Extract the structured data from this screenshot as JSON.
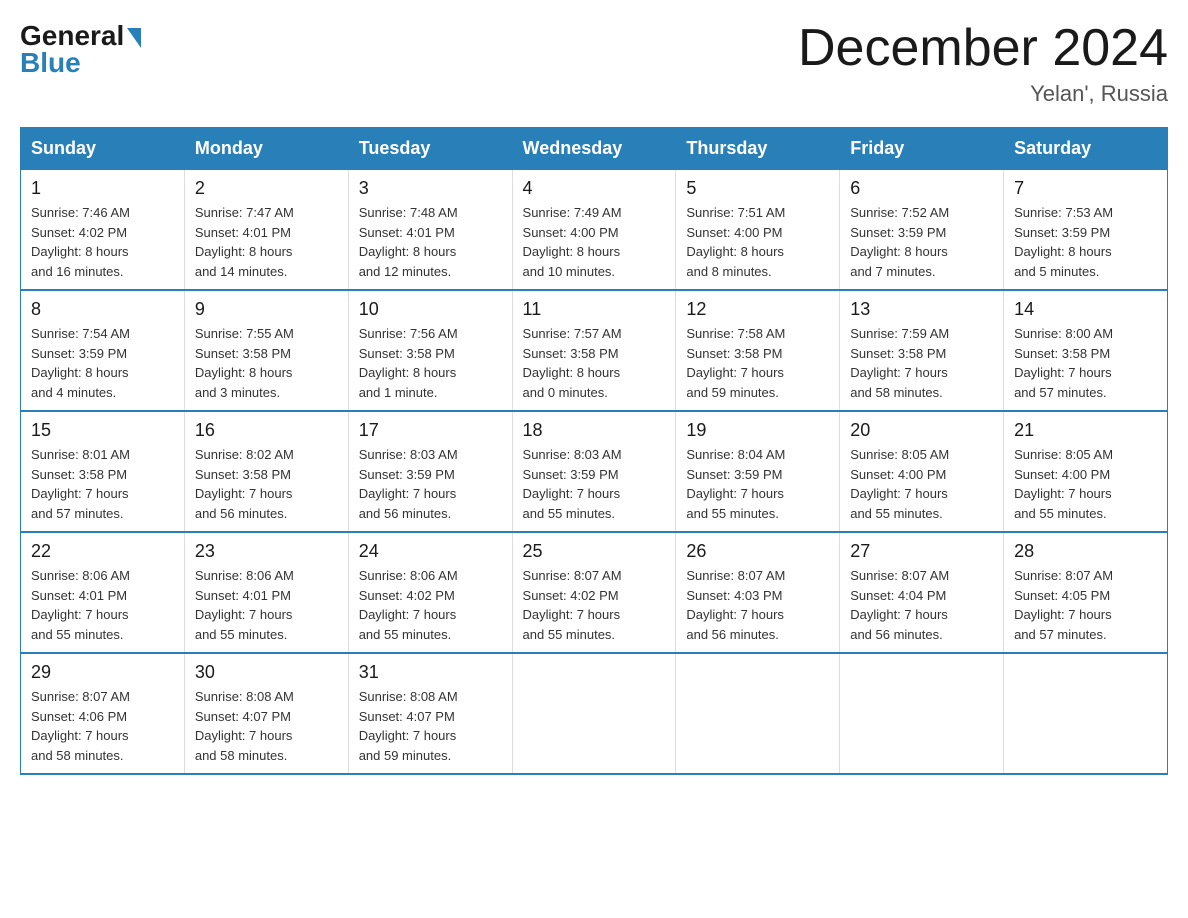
{
  "header": {
    "logo_general": "General",
    "logo_blue": "Blue",
    "month_title": "December 2024",
    "location": "Yelan', Russia"
  },
  "days_of_week": [
    "Sunday",
    "Monday",
    "Tuesday",
    "Wednesday",
    "Thursday",
    "Friday",
    "Saturday"
  ],
  "weeks": [
    [
      {
        "day": "1",
        "info": "Sunrise: 7:46 AM\nSunset: 4:02 PM\nDaylight: 8 hours\nand 16 minutes."
      },
      {
        "day": "2",
        "info": "Sunrise: 7:47 AM\nSunset: 4:01 PM\nDaylight: 8 hours\nand 14 minutes."
      },
      {
        "day": "3",
        "info": "Sunrise: 7:48 AM\nSunset: 4:01 PM\nDaylight: 8 hours\nand 12 minutes."
      },
      {
        "day": "4",
        "info": "Sunrise: 7:49 AM\nSunset: 4:00 PM\nDaylight: 8 hours\nand 10 minutes."
      },
      {
        "day": "5",
        "info": "Sunrise: 7:51 AM\nSunset: 4:00 PM\nDaylight: 8 hours\nand 8 minutes."
      },
      {
        "day": "6",
        "info": "Sunrise: 7:52 AM\nSunset: 3:59 PM\nDaylight: 8 hours\nand 7 minutes."
      },
      {
        "day": "7",
        "info": "Sunrise: 7:53 AM\nSunset: 3:59 PM\nDaylight: 8 hours\nand 5 minutes."
      }
    ],
    [
      {
        "day": "8",
        "info": "Sunrise: 7:54 AM\nSunset: 3:59 PM\nDaylight: 8 hours\nand 4 minutes."
      },
      {
        "day": "9",
        "info": "Sunrise: 7:55 AM\nSunset: 3:58 PM\nDaylight: 8 hours\nand 3 minutes."
      },
      {
        "day": "10",
        "info": "Sunrise: 7:56 AM\nSunset: 3:58 PM\nDaylight: 8 hours\nand 1 minute."
      },
      {
        "day": "11",
        "info": "Sunrise: 7:57 AM\nSunset: 3:58 PM\nDaylight: 8 hours\nand 0 minutes."
      },
      {
        "day": "12",
        "info": "Sunrise: 7:58 AM\nSunset: 3:58 PM\nDaylight: 7 hours\nand 59 minutes."
      },
      {
        "day": "13",
        "info": "Sunrise: 7:59 AM\nSunset: 3:58 PM\nDaylight: 7 hours\nand 58 minutes."
      },
      {
        "day": "14",
        "info": "Sunrise: 8:00 AM\nSunset: 3:58 PM\nDaylight: 7 hours\nand 57 minutes."
      }
    ],
    [
      {
        "day": "15",
        "info": "Sunrise: 8:01 AM\nSunset: 3:58 PM\nDaylight: 7 hours\nand 57 minutes."
      },
      {
        "day": "16",
        "info": "Sunrise: 8:02 AM\nSunset: 3:58 PM\nDaylight: 7 hours\nand 56 minutes."
      },
      {
        "day": "17",
        "info": "Sunrise: 8:03 AM\nSunset: 3:59 PM\nDaylight: 7 hours\nand 56 minutes."
      },
      {
        "day": "18",
        "info": "Sunrise: 8:03 AM\nSunset: 3:59 PM\nDaylight: 7 hours\nand 55 minutes."
      },
      {
        "day": "19",
        "info": "Sunrise: 8:04 AM\nSunset: 3:59 PM\nDaylight: 7 hours\nand 55 minutes."
      },
      {
        "day": "20",
        "info": "Sunrise: 8:05 AM\nSunset: 4:00 PM\nDaylight: 7 hours\nand 55 minutes."
      },
      {
        "day": "21",
        "info": "Sunrise: 8:05 AM\nSunset: 4:00 PM\nDaylight: 7 hours\nand 55 minutes."
      }
    ],
    [
      {
        "day": "22",
        "info": "Sunrise: 8:06 AM\nSunset: 4:01 PM\nDaylight: 7 hours\nand 55 minutes."
      },
      {
        "day": "23",
        "info": "Sunrise: 8:06 AM\nSunset: 4:01 PM\nDaylight: 7 hours\nand 55 minutes."
      },
      {
        "day": "24",
        "info": "Sunrise: 8:06 AM\nSunset: 4:02 PM\nDaylight: 7 hours\nand 55 minutes."
      },
      {
        "day": "25",
        "info": "Sunrise: 8:07 AM\nSunset: 4:02 PM\nDaylight: 7 hours\nand 55 minutes."
      },
      {
        "day": "26",
        "info": "Sunrise: 8:07 AM\nSunset: 4:03 PM\nDaylight: 7 hours\nand 56 minutes."
      },
      {
        "day": "27",
        "info": "Sunrise: 8:07 AM\nSunset: 4:04 PM\nDaylight: 7 hours\nand 56 minutes."
      },
      {
        "day": "28",
        "info": "Sunrise: 8:07 AM\nSunset: 4:05 PM\nDaylight: 7 hours\nand 57 minutes."
      }
    ],
    [
      {
        "day": "29",
        "info": "Sunrise: 8:07 AM\nSunset: 4:06 PM\nDaylight: 7 hours\nand 58 minutes."
      },
      {
        "day": "30",
        "info": "Sunrise: 8:08 AM\nSunset: 4:07 PM\nDaylight: 7 hours\nand 58 minutes."
      },
      {
        "day": "31",
        "info": "Sunrise: 8:08 AM\nSunset: 4:07 PM\nDaylight: 7 hours\nand 59 minutes."
      },
      {
        "day": "",
        "info": ""
      },
      {
        "day": "",
        "info": ""
      },
      {
        "day": "",
        "info": ""
      },
      {
        "day": "",
        "info": ""
      }
    ]
  ]
}
